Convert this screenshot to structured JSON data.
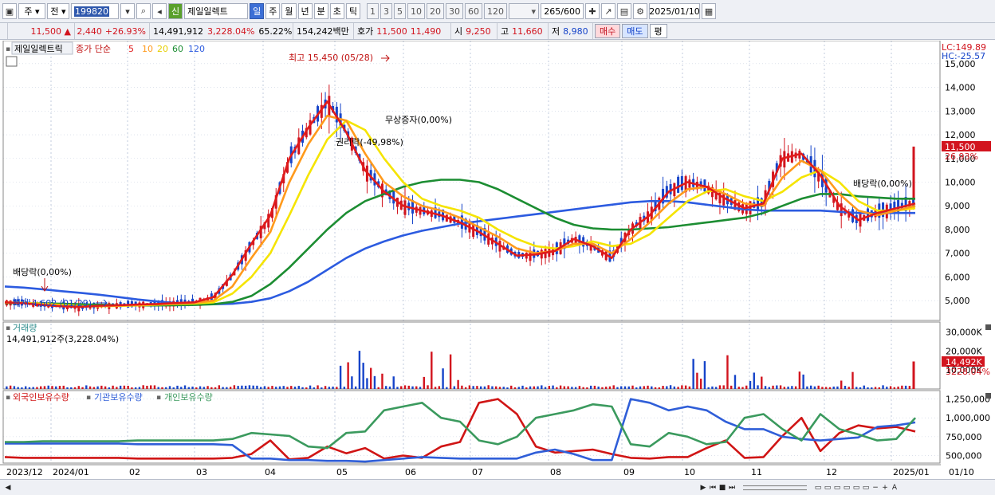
{
  "toolbar": {
    "mode": "주",
    "pre": "전",
    "code": "199820",
    "sin": "신",
    "name": "제일일렉트",
    "periods": [
      "일",
      "주",
      "월",
      "년",
      "분",
      "초",
      "틱"
    ],
    "active_period": "일",
    "intervals": [
      "1",
      "3",
      "5",
      "10",
      "20",
      "30",
      "60",
      "120"
    ],
    "count": "265",
    "count_total": "/600",
    "date": "2025/01/10"
  },
  "quote": {
    "price": "11,500",
    "arrow": "▲",
    "change": "2,440",
    "change_pct": "+26.93%",
    "volume": "14,491,912",
    "vol_pct": "3,228.04%",
    "ratio": "65.22%",
    "amount": "154,242백만",
    "hoga_label": "호가",
    "ask": "11,500",
    "bid": "11,490",
    "open_label": "시",
    "open": "9,250",
    "high_label": "고",
    "high": "11,660",
    "low_label": "저",
    "low": "8,980",
    "buy": "매수",
    "sell": "매도",
    "avg": "평"
  },
  "panel": {
    "name": "제일일렉트릭",
    "ma_title": "종가 단순",
    "ma_labels": [
      "5",
      "10",
      "20",
      "60",
      "120"
    ],
    "ma_colors": [
      "#e01b1b",
      "#ff9a1c",
      "#f5e400",
      "#1c8d32",
      "#2c5be0"
    ],
    "lc": "LC:149.89",
    "hc": "HC:-25.57",
    "price_tag": "11,500",
    "pct_tag": "26.93%",
    "vol_title": "거래량",
    "vol_value": "14,491,912주(3,228.04%)",
    "vol_tag": "14,492K",
    "vol_pct_tag": "3228.04%",
    "hold_labels": [
      "외국인보유수량",
      "기관보유수량",
      "개인보유수량"
    ],
    "hold_colors": [
      "#d01515",
      "#2f5ed8",
      "#3b9a5e"
    ]
  },
  "annotations": {
    "high": "최고 15,450 (05/28)",
    "low": "최저 4,602 (01/29)",
    "div1": "배당락(0,00%)",
    "div2": "배당락(0,00%)",
    "rights": "권리락(-49,98%)",
    "bonus": "무상증자(0,00%)"
  },
  "chart_data": {
    "type": "candlestick",
    "x": [
      "2023/12",
      "2024/01",
      "02",
      "03",
      "04",
      "05",
      "06",
      "07",
      "08",
      "09",
      "10",
      "11",
      "12",
      "2025/01",
      "01/10"
    ],
    "price_axis": {
      "ticks": [
        "15,000",
        "14,000",
        "13,000",
        "12,000",
        "11,000",
        "10,000",
        "9,000",
        "8,000",
        "7,000",
        "6,000",
        "5,000"
      ],
      "ylim": [
        4200,
        15800
      ]
    },
    "volume_axis": {
      "ticks": [
        "30,000K",
        "20,000K",
        "10,000K"
      ],
      "ylim": [
        0,
        34000
      ]
    },
    "holdings_axis": {
      "ticks": [
        "1,250,000",
        "1,000,000",
        "750,000",
        "500,000"
      ],
      "ylim": [
        400000,
        1330000
      ]
    },
    "series": [
      {
        "name": "5",
        "values": [
          4930,
          4890,
          4820,
          4760,
          4740,
          4790,
          4810,
          4840,
          4860,
          4900,
          4930,
          5150,
          6100,
          7400,
          8600,
          11000,
          12300,
          13400,
          12100,
          10500,
          9600,
          9000,
          8800,
          8600,
          8300,
          7900,
          7400,
          6900,
          6950,
          7100,
          7600,
          7300,
          6800,
          8000,
          8600,
          9600,
          10000,
          9800,
          9300,
          8900,
          9100,
          11000,
          11200,
          10300,
          9000,
          8400,
          8700,
          8900,
          9100
        ]
      },
      {
        "name": "10",
        "values": [
          4930,
          4900,
          4840,
          4780,
          4750,
          4770,
          4790,
          4820,
          4850,
          4880,
          4910,
          5000,
          5600,
          6800,
          7900,
          10000,
          11600,
          12800,
          12600,
          11200,
          10000,
          9400,
          9000,
          8800,
          8500,
          8100,
          7700,
          7200,
          7000,
          7100,
          7400,
          7400,
          7000,
          7600,
          8300,
          9100,
          9700,
          9800,
          9500,
          9100,
          9000,
          10200,
          10900,
          10500,
          9500,
          8800,
          8600,
          8800,
          9000
        ]
      },
      {
        "name": "20",
        "values": [
          4920,
          4910,
          4870,
          4820,
          4780,
          4760,
          4780,
          4800,
          4830,
          4860,
          4880,
          4930,
          5300,
          6000,
          7000,
          8600,
          10300,
          11800,
          12600,
          12200,
          11000,
          10000,
          9300,
          9000,
          8800,
          8500,
          8000,
          7600,
          7300,
          7200,
          7300,
          7500,
          7300,
          7400,
          7800,
          8500,
          9200,
          9600,
          9700,
          9400,
          9200,
          9600,
          10200,
          10500,
          10000,
          9200,
          8800,
          8800,
          8900
        ]
      },
      {
        "name": "60",
        "values": [
          4900,
          4900,
          4890,
          4870,
          4850,
          4830,
          4810,
          4800,
          4800,
          4810,
          4820,
          4850,
          4950,
          5200,
          5700,
          6400,
          7200,
          8000,
          8700,
          9200,
          9500,
          9800,
          10000,
          10100,
          10100,
          10000,
          9700,
          9300,
          8900,
          8500,
          8200,
          8050,
          8000,
          8000,
          8050,
          8100,
          8200,
          8300,
          8400,
          8500,
          8700,
          9000,
          9300,
          9500,
          9500,
          9400,
          9350,
          9300,
          9300
        ]
      },
      {
        "name": "120",
        "values": [
          5600,
          5550,
          5480,
          5400,
          5330,
          5250,
          5150,
          5050,
          4970,
          4900,
          4860,
          4850,
          4870,
          4950,
          5100,
          5400,
          5800,
          6300,
          6800,
          7200,
          7500,
          7750,
          7950,
          8100,
          8250,
          8350,
          8450,
          8550,
          8650,
          8750,
          8850,
          8950,
          9050,
          9150,
          9200,
          9200,
          9150,
          9050,
          8950,
          8850,
          8800,
          8800,
          8800,
          8800,
          8750,
          8700,
          8700,
          8700,
          8700
        ]
      }
    ],
    "holdings": [
      {
        "name": "외국인보유수량",
        "values": [
          480000,
          470000,
          470000,
          470000,
          470000,
          470000,
          470000,
          460000,
          460000,
          460000,
          460000,
          460000,
          470000,
          520000,
          700000,
          450000,
          470000,
          620000,
          530000,
          600000,
          460000,
          500000,
          470000,
          620000,
          680000,
          1200000,
          1250000,
          1050000,
          620000,
          540000,
          560000,
          580000,
          520000,
          470000,
          460000,
          480000,
          480000,
          600000,
          700000,
          470000,
          480000,
          760000,
          1000000,
          560000,
          800000,
          900000,
          860000,
          880000,
          820000
        ]
      },
      {
        "name": "기관보유수량",
        "values": [
          660000,
          660000,
          660000,
          660000,
          660000,
          660000,
          660000,
          650000,
          650000,
          650000,
          650000,
          650000,
          640000,
          460000,
          460000,
          440000,
          440000,
          430000,
          430000,
          420000,
          440000,
          460000,
          480000,
          470000,
          460000,
          460000,
          460000,
          460000,
          540000,
          580000,
          520000,
          440000,
          440000,
          1250000,
          1200000,
          1100000,
          1150000,
          1100000,
          950000,
          850000,
          850000,
          750000,
          720000,
          700000,
          720000,
          740000,
          880000,
          900000,
          940000
        ]
      },
      {
        "name": "개인보유수량",
        "values": [
          680000,
          680000,
          690000,
          690000,
          690000,
          690000,
          690000,
          700000,
          700000,
          700000,
          700000,
          700000,
          720000,
          800000,
          780000,
          760000,
          620000,
          600000,
          800000,
          820000,
          1100000,
          1150000,
          1200000,
          1000000,
          950000,
          700000,
          650000,
          750000,
          1000000,
          1050000,
          1100000,
          1180000,
          1150000,
          650000,
          620000,
          800000,
          750000,
          650000,
          680000,
          1000000,
          1050000,
          850000,
          700000,
          1050000,
          850000,
          780000,
          700000,
          720000,
          1000000
        ]
      }
    ],
    "last": {
      "close": 11500,
      "volume_k": 14492
    }
  }
}
